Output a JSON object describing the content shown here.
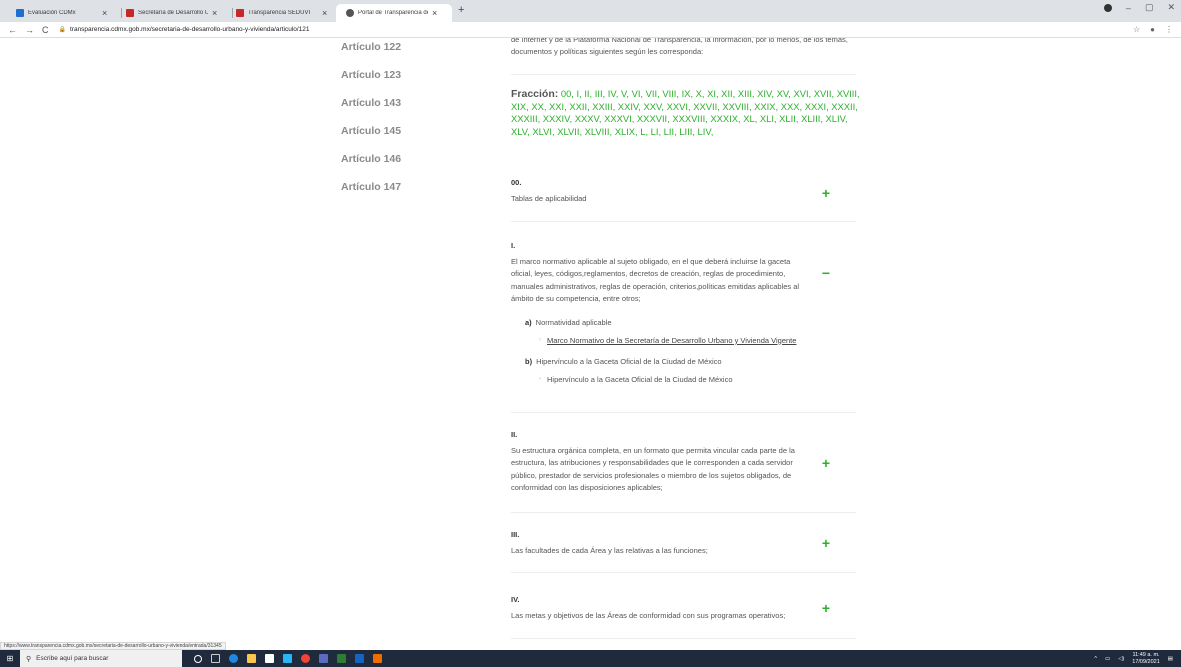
{
  "browser": {
    "tabs": [
      {
        "label": "Evaluación CDMx",
        "icon": "chart-icon",
        "color": "#1f6fd1"
      },
      {
        "label": "Secretaría de Desarrollo Urbano",
        "icon": "doc-icon",
        "color": "#c62828"
      },
      {
        "label": "Transparencia SEDUVI",
        "icon": "doc-icon",
        "color": "#c62828"
      },
      {
        "label": "Portal de Transparencia de la CDMX",
        "icon": "globe-icon",
        "color": "#555555"
      }
    ],
    "new_tab": "+",
    "url": "transparencia.cdmx.gob.mx/secretaria-de-desarrollo-urbano-y-vivienda/articulo/121"
  },
  "sidebar": {
    "items": [
      "Artículo 122",
      "Artículo 123",
      "Artículo 143",
      "Artículo 145",
      "Artículo 146",
      "Artículo 147"
    ]
  },
  "content": {
    "intro": "de Internet y de la Plataforma Nacional de Transparencia, la información, por lo menos, de los temas, documentos y políticas siguientes según les corresponda:",
    "fraccion_label": "Fracción:",
    "fracciones": "00, I, II, III, IV, V, VI, VII, VIII, IX, X, XI, XII, XIII, XIV, XV, XVI, XVII, XVIII, XIX, XX, XXI, XXII, XXIII, XXIV, XXV, XXVI, XXVII, XXVIII, XXIX, XXX, XXXI, XXXII, XXXIII, XXXIV, XXXV, XXXVI, XXXVII, XXXVIII, XXXIX, XL, XLI, XLII, XLIII, XLIV, XLV, XLVI, XLVII, XLVIII, XLIX, L, LI, LII, LIII, LIV,",
    "sections": [
      {
        "num": "00.",
        "text": "Tablas de aplicabilidad",
        "toggle": "+"
      },
      {
        "num": "I.",
        "text": "El marco normativo aplicable al sujeto obligado, en el que deberá incluirse la gaceta oficial, leyes, códigos,reglamentos, decretos de creación, reglas de procedimiento, manuales administrativos, reglas de operación, criterios,políticas emitidas aplicables al ámbito de su competencia, entre otros;",
        "toggle": "−",
        "subitems": [
          {
            "letter": "a)",
            "label": "Normatividad aplicable",
            "link": "Marco Normativo de la Secretaría de Desarrollo Urbano y Vivienda Vigente"
          },
          {
            "letter": "b)",
            "label": "Hipervínculo a la Gaceta Oficial de la Ciudad de México",
            "link": "Hipervínculo a la Gaceta Oficial de la Ciudad de México"
          }
        ]
      },
      {
        "num": "II.",
        "text": "Su estructura orgánica completa, en un formato que permita vincular cada parte de la estructura, las atribuciones y responsabilidades que le corresponden a cada servidor público, prestador de servicios profesionales o miembro de los sujetos obligados, de conformidad con las disposiciones aplicables;",
        "toggle": "+"
      },
      {
        "num": "III.",
        "text": "Las facultades de cada Área y las relativas a las funciones;",
        "toggle": "+"
      },
      {
        "num": "IV.",
        "text": "Las metas y objetivos de las Áreas de conformidad con sus programas operativos;",
        "toggle": "+"
      }
    ]
  },
  "status_url": "https://www.transparencia.cdmx.gob.mx/secretaria-de-desarrollo-urbano-y-vivienda/entrada/31345",
  "taskbar": {
    "search_placeholder": "Escribe aquí para buscar",
    "time": "11:49 a. m.",
    "date": "17/09/2021"
  },
  "colors": {
    "accent_green": "#2bb02b",
    "taskbar": "#1f2a3c"
  }
}
